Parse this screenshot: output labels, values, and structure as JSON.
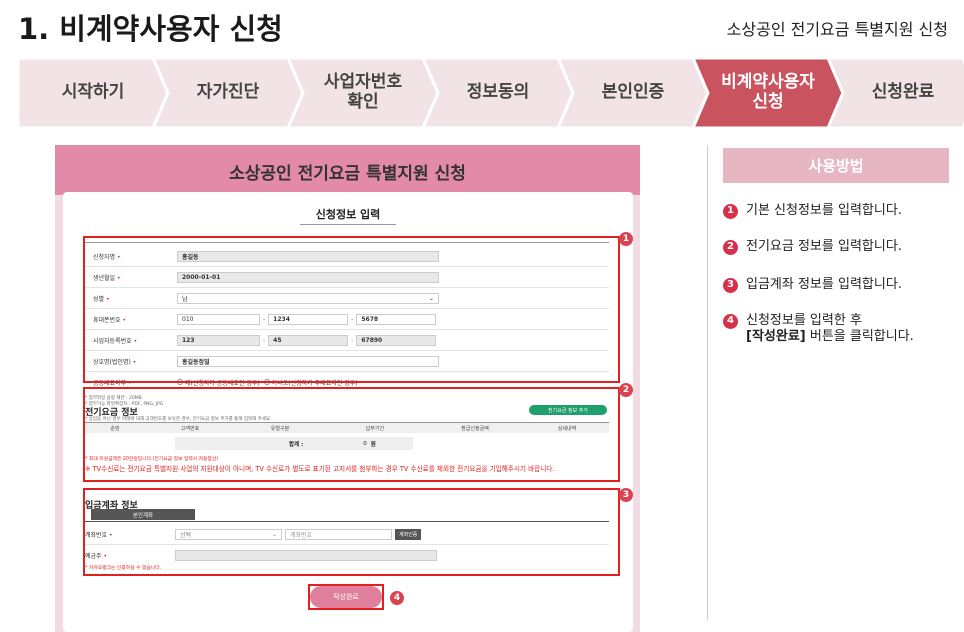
{
  "page": {
    "title": "1. 비계약사용자 신청",
    "subtitle": "소상공인 전기요금 특별지원 신청"
  },
  "steps": [
    {
      "label": "시작하기",
      "active": false
    },
    {
      "label": "자가진단",
      "active": false
    },
    {
      "label": "사업자번호\n확인",
      "active": false
    },
    {
      "label": "정보동의",
      "active": false
    },
    {
      "label": "본인인증",
      "active": false
    },
    {
      "label": "비계약사용자\n신청",
      "active": true
    },
    {
      "label": "신청완료",
      "active": false
    }
  ],
  "colors": {
    "step_inactive": "#f2e4e6",
    "step_active": "#c9545f",
    "accent": "#d9304a",
    "highlight": "#e32020"
  },
  "form": {
    "header": "소상공인 전기요금 특별지원 신청",
    "card_title": "신청정보 입력",
    "applicant": {
      "name_label": "신청자명",
      "name_value": "홍길동",
      "birth_label": "생년월일",
      "birth_value": "2000-01-01",
      "gender_label": "성별",
      "gender_value": "남",
      "phone_label": "휴대폰번호",
      "phone_1": "010",
      "phone_2": "1234",
      "phone_3": "5678",
      "bizno_label": "사업자등록번호",
      "bizno_1": "123",
      "bizno_2": "45",
      "bizno_3": "67890",
      "company_label": "상호명(법인명)",
      "company_value": "홍길동정밀",
      "rep_label": "공동대표여부",
      "rep_opt_yes": "예(신청자가 공동대표인 경우)",
      "rep_opt_no": "아니오(신청자가 주대표자인 경우)",
      "note1": "* 첨부파일 용량 제한 : 20MB",
      "note2": "* 첨부가능 파일확장자 : PDF, PNG, JPG"
    },
    "electric": {
      "title": "전기요금 정보",
      "desc": "* 상업용 아닌 경우 아래에 대해 고객번호를 보유한 경우, 전기요금 정보 추가를 통해 입력해 주세요.",
      "add_button": "전기요금 정보 추가",
      "columns": [
        "순번",
        "고객번호",
        "유형구분",
        "납부기간",
        "환급신청금액",
        "상세내역"
      ],
      "total_label": "합계 :",
      "total_value": "0",
      "total_unit": "원",
      "note_small": "* 최대 지원금액은 20만원입니다.(전기요금 정보 입력시 자동합산)",
      "note_large": "※ TV수신료는 전기요금 특별지원 사업의 지원대상이 아니며, TV 수신료가 별도로 표기된 고지서를 첨부하는 경우 TV 수신료를 제외한 전기요금을 기입해주시기 바랍니다."
    },
    "account": {
      "title": "입금계좌 정보",
      "tab": "본인계좌",
      "account_label": "계좌번호",
      "bank_placeholder": "선택",
      "number_placeholder": "계좌번호",
      "verify_button": "계좌인증",
      "holder_label": "예금주",
      "note": "* 카카오뱅크는 인증하실 수 없습니다."
    },
    "submit_label": "작성완료"
  },
  "markers": [
    "1",
    "2",
    "3",
    "4"
  ],
  "howto": {
    "title": "사용방법",
    "items": [
      {
        "num": "1",
        "text": "기본 신청정보를 입력합니다."
      },
      {
        "num": "2",
        "text": "전기요금 정보를 입력합니다."
      },
      {
        "num": "3",
        "text": "입금계좌 정보를 입력합니다."
      },
      {
        "num": "4",
        "text": "신청정보를 입력한 후",
        "bold": "[작성완료]",
        "rest": " 버튼을 클릭합니다."
      }
    ]
  }
}
